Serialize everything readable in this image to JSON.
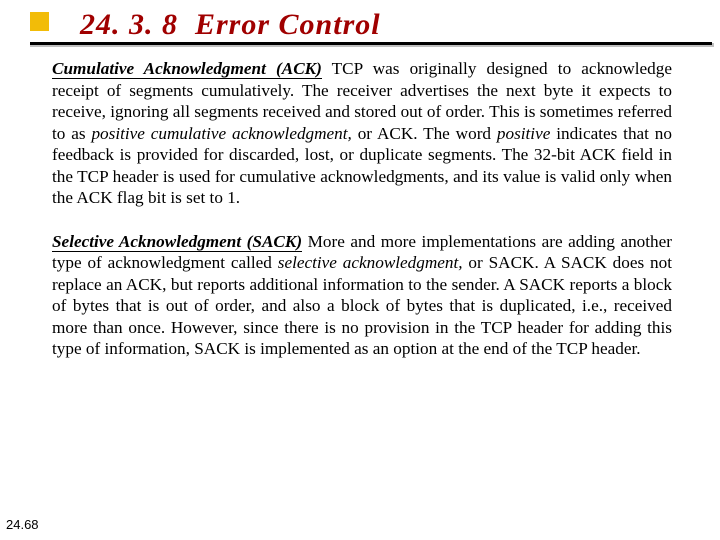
{
  "heading": {
    "number": "24. 3. 8",
    "title": "Error Control"
  },
  "para1": {
    "lead_biu": "Cumulative Acknowledgment (ACK)",
    "t1": " TCP was originally designed to acknowledge receipt of segments cumulatively. The receiver advertises the next byte it expects to receive, ignoring all segments received and stored out of order. This is sometimes referred to as ",
    "em1": "positive cumulative acknowledgment,",
    "t2": " or ACK. The word ",
    "em2": "positive",
    "t3": " indicates that no feedback is provided for discarded, lost, or duplicate segments. The 32-bit ACK field in the TCP header is used for cumulative acknowledgments, and its value is valid only when the ACK flag bit is set to 1."
  },
  "para2": {
    "lead_biu": "Selective Acknowledgment (SACK)",
    "t1": " More and more implementations are adding another type of acknowledgment called ",
    "em1": "selective acknowledgment,",
    "t2": " or SACK. A SACK does not replace an ACK, but reports additional information to the sender. A SACK reports a block of bytes that is out of order, and also a block of bytes that is duplicated, i.e., received more than once. However, since there is no provision in the TCP header for adding this type of information, SACK is implemented as an option at the end of the TCP header."
  },
  "pagenum": "24.68"
}
